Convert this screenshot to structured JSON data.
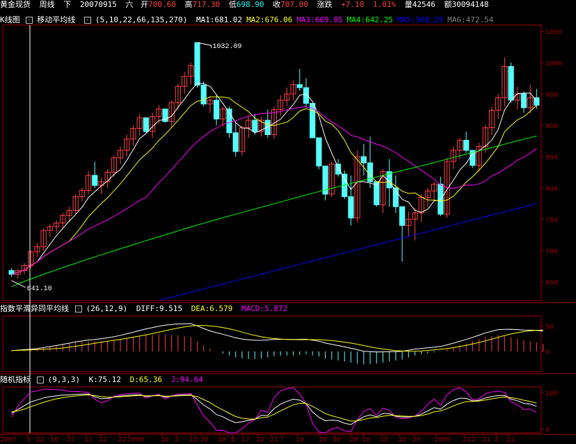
{
  "header": {
    "instrument": "黄金现货",
    "period": "周线",
    "direction": "下",
    "date": "20070915",
    "weekday": "六",
    "open_label": "开",
    "open": "700.60",
    "high_label": "高",
    "high": "717.30",
    "low_label": "低",
    "low": "698.90",
    "close_label": "收",
    "close": "707.00",
    "change_label": "涨跌",
    "change": "+7.10",
    "change_pct": "1.01%",
    "volume_label": "量",
    "volume": "42546",
    "amount_label": "额",
    "amount": "30094148"
  },
  "main_panel": {
    "chart_label": "K线图",
    "indicator_label": "移动平均线",
    "params": "(5,10,22,66,135,270)",
    "ma": [
      {
        "name": "MA1",
        "value": "681.02",
        "color": "#ffffff"
      },
      {
        "name": "MA2",
        "value": "676.06",
        "color": "#ffff00"
      },
      {
        "name": "MA3",
        "value": "669.85",
        "color": "#ff00ff"
      },
      {
        "name": "MA4",
        "value": "642.25",
        "color": "#00ff00"
      },
      {
        "name": "MA5",
        "value": "568.29",
        "color": "#0000ff"
      },
      {
        "name": "MA6",
        "value": "472.54",
        "color": "#808080"
      }
    ],
    "high_marker": "1032.09",
    "low_marker": "641.10",
    "y_ticks": [
      "1050",
      "1000",
      "950",
      "900",
      "850",
      "800",
      "750",
      "700",
      "650"
    ]
  },
  "macd_panel": {
    "label": "指数平滑异同平均线",
    "params": "(26,12,9)",
    "diff": "DIFF:9.515",
    "dea": "DEA:6.579",
    "macd": "MACD:5.872",
    "y_ticks": [
      "50",
      "0"
    ]
  },
  "kdj_panel": {
    "label": "随机指标",
    "params": "(9,3,3)",
    "k": "K:75.12",
    "d": "D:65.36",
    "j": "J:94.64",
    "y_ticks": [
      "100",
      "0"
    ]
  },
  "x_axis": {
    "labels": [
      "2007",
      "9",
      "22",
      "10",
      "27",
      "17",
      "12",
      "22",
      "2008",
      "16",
      "3",
      "15",
      "29",
      "19",
      "5",
      "17",
      "31",
      "21",
      "7",
      "19",
      "16",
      "30",
      "20",
      "10",
      "25",
      "15",
      "29",
      "2009",
      "21",
      "2",
      "21",
      "3",
      "21"
    ]
  },
  "chart_data": {
    "type": "candlestick",
    "title": "黄金现货 周线",
    "ylim": [
      620,
      1060
    ],
    "candles": [
      [
        668,
        672,
        658,
        662
      ],
      [
        662,
        670,
        655,
        668
      ],
      [
        668,
        680,
        662,
        676
      ],
      [
        676,
        700,
        672,
        698
      ],
      [
        698,
        712,
        690,
        706
      ],
      [
        706,
        735,
        700,
        732
      ],
      [
        732,
        742,
        722,
        738
      ],
      [
        738,
        748,
        728,
        744
      ],
      [
        744,
        760,
        736,
        756
      ],
      [
        756,
        770,
        748,
        764
      ],
      [
        764,
        790,
        758,
        786
      ],
      [
        786,
        800,
        778,
        796
      ],
      [
        796,
        826,
        790,
        820
      ],
      [
        820,
        842,
        800,
        804
      ],
      [
        804,
        816,
        790,
        810
      ],
      [
        810,
        830,
        800,
        825
      ],
      [
        825,
        852,
        818,
        848
      ],
      [
        848,
        866,
        838,
        860
      ],
      [
        860,
        885,
        850,
        878
      ],
      [
        878,
        900,
        868,
        895
      ],
      [
        895,
        918,
        884,
        912
      ],
      [
        912,
        904,
        888,
        890
      ],
      [
        890,
        920,
        880,
        914
      ],
      [
        914,
        932,
        902,
        926
      ],
      [
        926,
        926,
        904,
        906
      ],
      [
        906,
        940,
        896,
        936
      ],
      [
        936,
        966,
        925,
        962
      ],
      [
        962,
        985,
        950,
        978
      ],
      [
        978,
        1000,
        965,
        995
      ],
      [
        1032,
        1032,
        960,
        964
      ],
      [
        964,
        970,
        930,
        934
      ],
      [
        934,
        946,
        920,
        940
      ],
      [
        940,
        948,
        900,
        910
      ],
      [
        910,
        930,
        898,
        926
      ],
      [
        926,
        930,
        880,
        888
      ],
      [
        888,
        905,
        850,
        858
      ],
      [
        858,
        900,
        852,
        896
      ],
      [
        896,
        915,
        880,
        908
      ],
      [
        908,
        918,
        885,
        890
      ],
      [
        890,
        914,
        882,
        908
      ],
      [
        908,
        925,
        880,
        885
      ],
      [
        885,
        930,
        878,
        925
      ],
      [
        925,
        948,
        915,
        940
      ],
      [
        940,
        960,
        930,
        950
      ],
      [
        950,
        972,
        940,
        965
      ],
      [
        965,
        990,
        955,
        960
      ],
      [
        960,
        975,
        930,
        935
      ],
      [
        935,
        926,
        880,
        880
      ],
      [
        880,
        860,
        830,
        835
      ],
      [
        835,
        828,
        780,
        790
      ],
      [
        790,
        842,
        785,
        838
      ],
      [
        838,
        846,
        818,
        822
      ],
      [
        822,
        828,
        782,
        786
      ],
      [
        786,
        820,
        740,
        752
      ],
      [
        752,
        860,
        745,
        850
      ],
      [
        850,
        870,
        820,
        840
      ],
      [
        840,
        882,
        800,
        810
      ],
      [
        810,
        808,
        770,
        773
      ],
      [
        773,
        830,
        760,
        826
      ],
      [
        826,
        846,
        770,
        800
      ],
      [
        800,
        820,
        760,
        770
      ],
      [
        770,
        764,
        682,
        740
      ],
      [
        740,
        762,
        722,
        750
      ],
      [
        750,
        768,
        716,
        760
      ],
      [
        760,
        790,
        745,
        785
      ],
      [
        785,
        800,
        770,
        795
      ],
      [
        795,
        810,
        780,
        806
      ],
      [
        806,
        818,
        755,
        758
      ],
      [
        758,
        848,
        752,
        842
      ],
      [
        842,
        866,
        830,
        860
      ],
      [
        860,
        880,
        846,
        876
      ],
      [
        876,
        890,
        856,
        860
      ],
      [
        860,
        858,
        832,
        836
      ],
      [
        836,
        872,
        826,
        866
      ],
      [
        866,
        900,
        856,
        896
      ],
      [
        896,
        930,
        884,
        924
      ],
      [
        924,
        950,
        910,
        944
      ],
      [
        944,
        1008,
        930,
        994
      ],
      [
        994,
        1000,
        936,
        940
      ],
      [
        940,
        962,
        925,
        950
      ],
      [
        950,
        954,
        920,
        928
      ],
      [
        928,
        965,
        918,
        944
      ],
      [
        944,
        958,
        926,
        932
      ]
    ],
    "ma_series": [
      {
        "name": "MA1",
        "color": "#ffffff"
      },
      {
        "name": "MA2",
        "color": "#ffff00"
      },
      {
        "name": "MA3",
        "color": "#ff00ff"
      },
      {
        "name": "MA4",
        "color": "#00ff00"
      },
      {
        "name": "MA5",
        "color": "#0000ff"
      }
    ],
    "macd_hist": [
      2,
      3,
      4,
      5,
      6,
      8,
      10,
      12,
      14,
      16,
      18,
      19,
      20,
      20,
      20,
      21,
      22,
      24,
      26,
      28,
      30,
      32,
      33,
      34,
      34,
      33,
      32,
      30,
      28,
      20,
      12,
      5,
      0,
      -4,
      -8,
      -12,
      -14,
      -15,
      -15,
      -14,
      -12,
      -10,
      -9,
      -8,
      -8,
      -7,
      -6,
      -8,
      -10,
      -14,
      -16,
      -18,
      -20,
      -22,
      -24,
      -26,
      -25,
      -24,
      -22,
      -20,
      -18,
      -16,
      -12,
      -8,
      -6,
      -4,
      -2,
      0,
      4,
      8,
      12,
      16,
      20,
      24,
      28,
      30,
      32,
      30,
      28,
      25,
      22,
      20,
      18,
      15
    ],
    "macd_ylim": [
      -40,
      70
    ],
    "kdj_ylim": [
      -10,
      115
    ]
  }
}
